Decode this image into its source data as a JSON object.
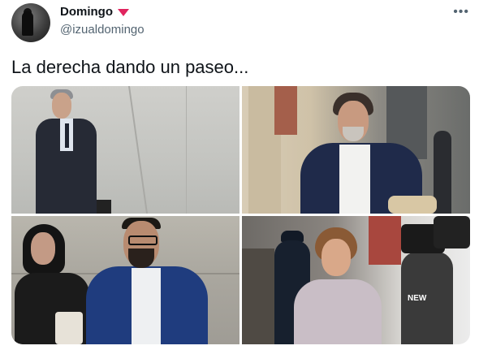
{
  "tweet": {
    "author": {
      "name": "Domingo",
      "handle": "@izualdomingo"
    },
    "text": "La derecha dando un paseo...",
    "more_icon": "more-horizontal-icon",
    "badge_icon": "heart-icon",
    "badge_color": "#e0245e",
    "photo_tag": "NEW"
  }
}
